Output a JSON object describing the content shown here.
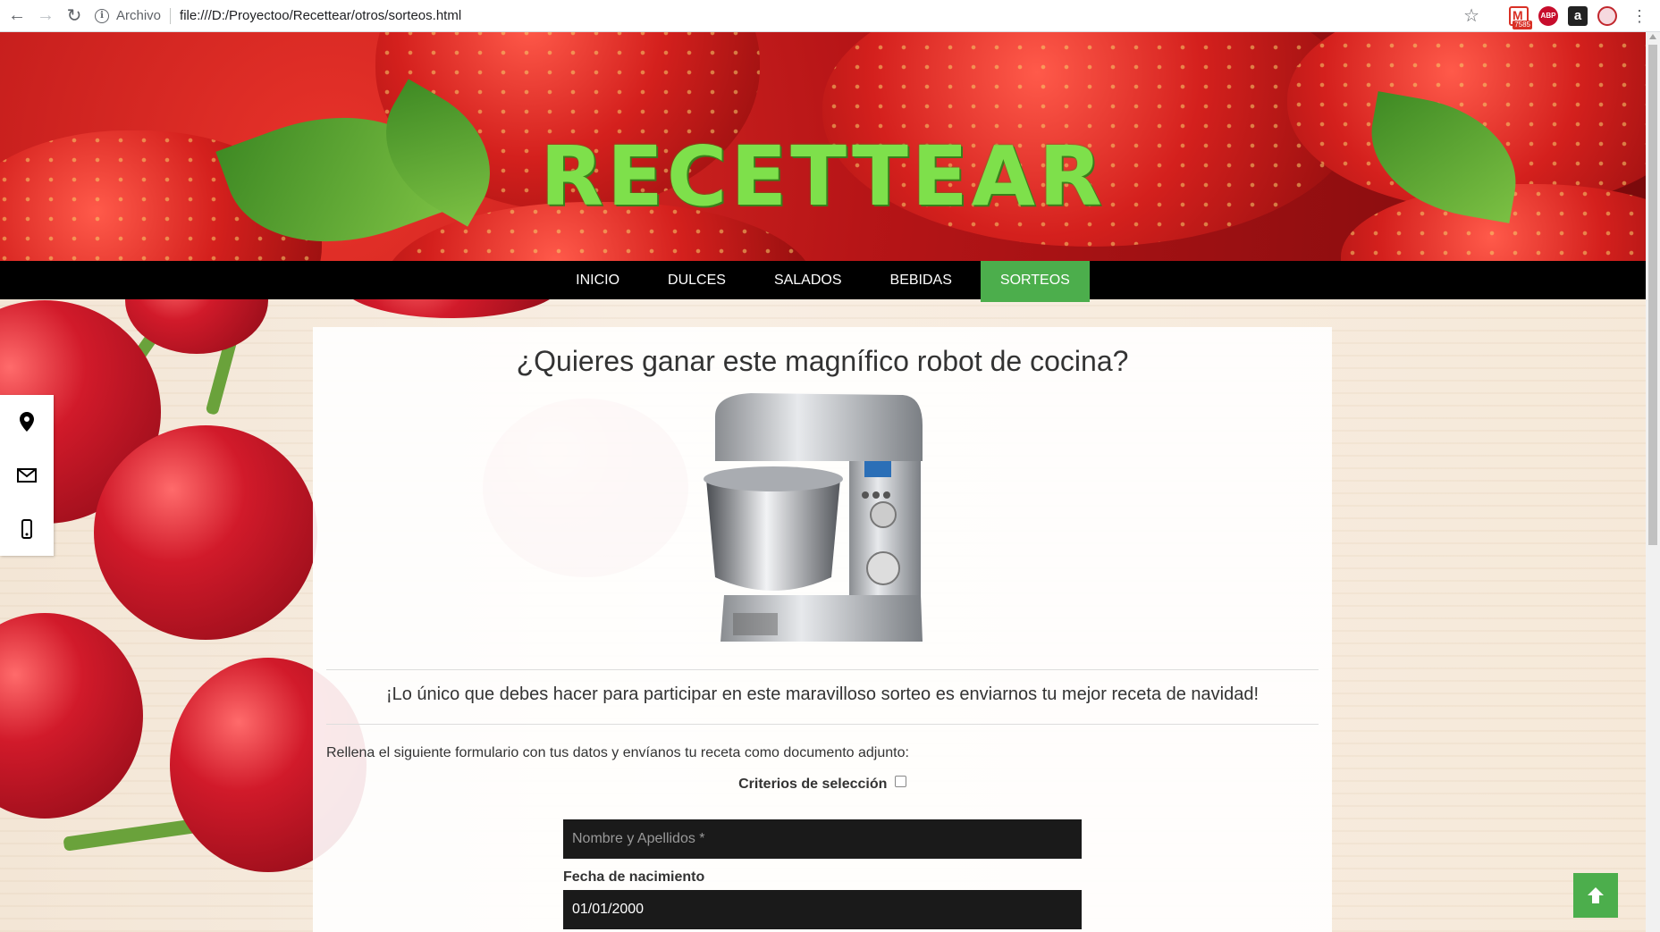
{
  "browser": {
    "scheme_label": "Archivo",
    "url": "file:///D:/Proyectoo/Recettear/otros/sorteos.html",
    "extensions": {
      "gmail_badge": "7585",
      "abp_label": "ABP",
      "amazon_label": "a"
    }
  },
  "site": {
    "logo": "RECETTEAR",
    "nav": [
      "INICIO",
      "DULCES",
      "SALADOS",
      "BEBIDAS",
      "SORTEOS"
    ],
    "active_nav": "SORTEOS"
  },
  "sidebar": {
    "icons": [
      "map-marker-icon",
      "envelope-icon",
      "mobile-phone-icon"
    ]
  },
  "contest": {
    "title": "¿Quieres ganar este magnífico robot de cocina?",
    "lead": "¡Lo único que debes hacer para participar en este maravilloso sorteo es enviarnos tu mejor receta de navidad!",
    "instructions": "Rellena el siguiente formulario con tus datos y envíanos tu receta como documento adjunto:",
    "criteria_label": "Criterios de selección",
    "form": {
      "name_placeholder": "Nombre y Apellidos *",
      "birth_label": "Fecha de nacimiento",
      "birth_value": "01/01/2000"
    }
  },
  "colors": {
    "accent_green": "#4cae4c",
    "nav_bg": "#000000",
    "field_bg": "#1a1a1a",
    "logo_green": "#7ee04b"
  }
}
